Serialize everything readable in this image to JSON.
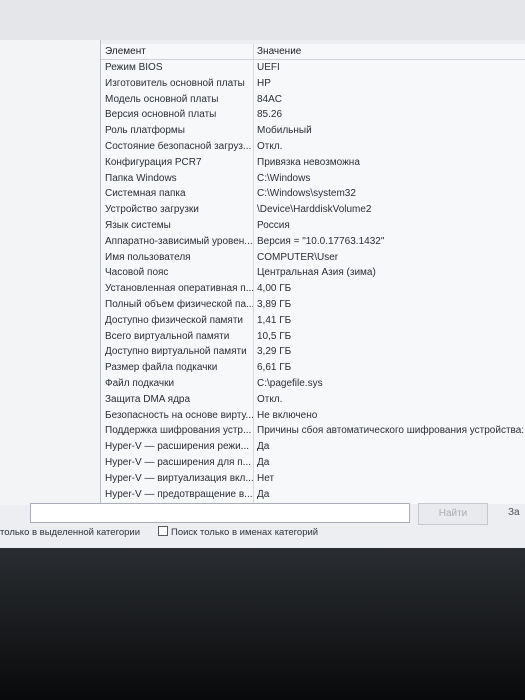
{
  "table": {
    "col_element": "Элемент",
    "col_value": "Значение",
    "rows": [
      {
        "name": "Режим BIOS",
        "value": "UEFI"
      },
      {
        "name": "Изготовитель основной платы",
        "value": "HP"
      },
      {
        "name": "Модель основной платы",
        "value": "84AC"
      },
      {
        "name": "Версия основной платы",
        "value": "85.26"
      },
      {
        "name": "Роль платформы",
        "value": "Мобильный"
      },
      {
        "name": "Состояние безопасной загруз...",
        "value": "Откл."
      },
      {
        "name": "Конфигурация PCR7",
        "value": "Привязка невозможна"
      },
      {
        "name": "Папка Windows",
        "value": "C:\\Windows"
      },
      {
        "name": "Системная папка",
        "value": "C:\\Windows\\system32"
      },
      {
        "name": "Устройство загрузки",
        "value": "\\Device\\HarddiskVolume2"
      },
      {
        "name": "Язык системы",
        "value": "Россия"
      },
      {
        "name": "Аппаратно-зависимый уровен...",
        "value": "Версия = \"10.0.17763.1432\""
      },
      {
        "name": "Имя пользователя",
        "value": "COMPUTER\\User"
      },
      {
        "name": "Часовой пояс",
        "value": "Центральная Азия (зима)"
      },
      {
        "name": "Установленная оперативная п...",
        "value": "4,00 ГБ"
      },
      {
        "name": "Полный объем физической па...",
        "value": "3,89 ГБ"
      },
      {
        "name": "Доступно физической памяти",
        "value": "1,41 ГБ"
      },
      {
        "name": "Всего виртуальной памяти",
        "value": "10,5 ГБ"
      },
      {
        "name": "Доступно виртуальной памяти",
        "value": "3,29 ГБ"
      },
      {
        "name": "Размер файла подкачки",
        "value": "6,61 ГБ"
      },
      {
        "name": "Файл подкачки",
        "value": "C:\\pagefile.sys"
      },
      {
        "name": "Защита DMA ядра",
        "value": "Откл."
      },
      {
        "name": "Безопасность на основе вирту...",
        "value": "Не включено"
      },
      {
        "name": "Поддержка шифрования устр...",
        "value": "Причины сбоя автоматического шифрования устройства: Доступ"
      },
      {
        "name": "Hyper-V — расширения режи...",
        "value": "Да"
      },
      {
        "name": "Hyper-V — расширения для п...",
        "value": "Да"
      },
      {
        "name": "Hyper-V — виртуализация вкл...",
        "value": "Нет"
      },
      {
        "name": "Hyper-V — предотвращение в...",
        "value": "Да"
      }
    ]
  },
  "search": {
    "find_label": "Найти",
    "close_label": "За",
    "search_selected_label": "только в выделенной категории",
    "search_names_label": "Поиск только в именах категорий"
  }
}
